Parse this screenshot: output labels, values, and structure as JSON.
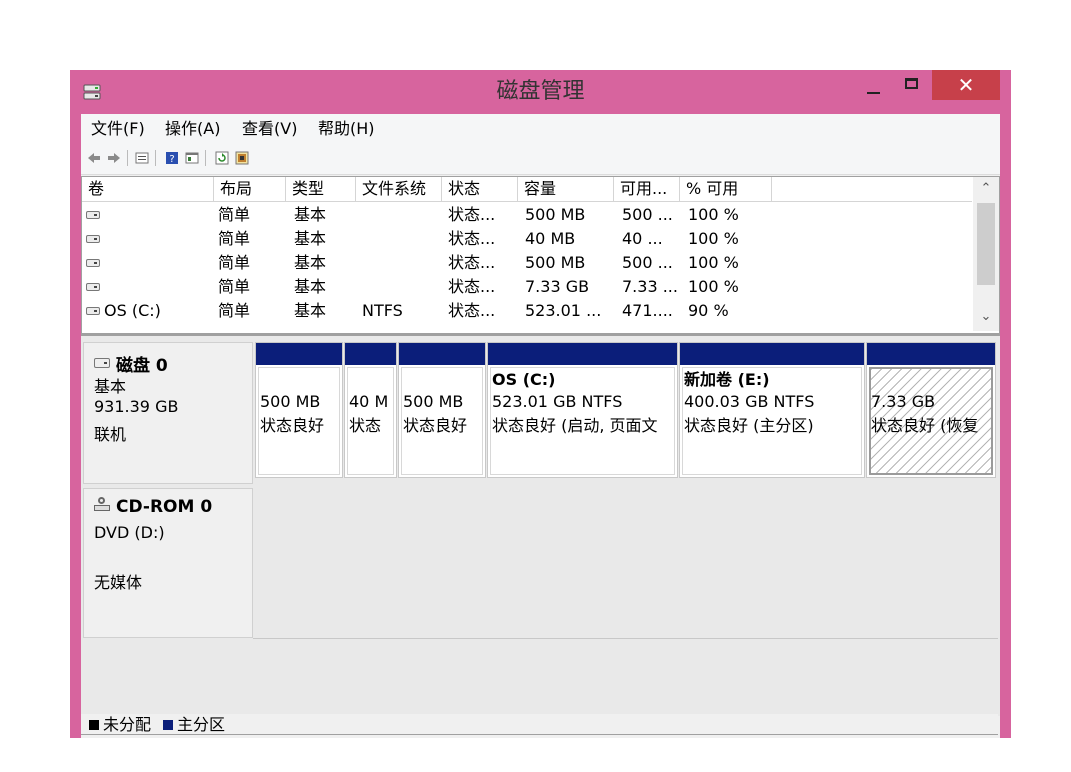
{
  "window": {
    "title": "磁盘管理",
    "close_glyph": "✕"
  },
  "menu": [
    {
      "label": "文件(F)"
    },
    {
      "label": "操作(A)"
    },
    {
      "label": "查看(V)"
    },
    {
      "label": "帮助(H)"
    }
  ],
  "toolbar": [
    "back-icon",
    "forward-icon",
    "properties-icon",
    "help-icon",
    "console-tree-icon",
    "refresh-icon",
    "settings-icon"
  ],
  "volumes": {
    "headers": [
      "卷",
      "布局",
      "类型",
      "文件系统",
      "状态",
      "容量",
      "可用...",
      "% 可用"
    ],
    "rows": [
      {
        "name": "",
        "layout": "简单",
        "type": "基本",
        "fs": "",
        "status": "状态...",
        "capacity": "500 MB",
        "free": "500 ...",
        "pct": "100 %"
      },
      {
        "name": "",
        "layout": "简单",
        "type": "基本",
        "fs": "",
        "status": "状态...",
        "capacity": "40 MB",
        "free": "40 ...",
        "pct": "100 %"
      },
      {
        "name": "",
        "layout": "简单",
        "type": "基本",
        "fs": "",
        "status": "状态...",
        "capacity": "500 MB",
        "free": "500 ...",
        "pct": "100 %"
      },
      {
        "name": "",
        "layout": "简单",
        "type": "基本",
        "fs": "",
        "status": "状态...",
        "capacity": "7.33 GB",
        "free": "7.33 ...",
        "pct": "100 %"
      },
      {
        "name": "OS (C:)",
        "layout": "简单",
        "type": "基本",
        "fs": "NTFS",
        "status": "状态...",
        "capacity": "523.01 ...",
        "free": "471....",
        "pct": "90 %"
      }
    ]
  },
  "disks": [
    {
      "name": "磁盘 0",
      "type": "基本",
      "size": "931.39 GB",
      "state": "联机",
      "partitions": [
        {
          "title": "",
          "line1": "500 MB",
          "line2": "状态良好"
        },
        {
          "title": "",
          "line1": "40 M",
          "line2": "状态"
        },
        {
          "title": "",
          "line1": "500 MB",
          "line2": "状态良好"
        },
        {
          "title": "OS  (C:)",
          "line1": "523.01 GB NTFS",
          "line2": "状态良好 (启动, 页面文"
        },
        {
          "title": "新加卷  (E:)",
          "line1": "400.03 GB NTFS",
          "line2": "状态良好 (主分区)"
        },
        {
          "title": "",
          "line1": "7.33 GB",
          "line2": "状态良好 (恢复"
        }
      ]
    },
    {
      "name": "CD-ROM 0",
      "type": "DVD (D:)",
      "size": "",
      "state": "无媒体"
    }
  ],
  "legend": [
    {
      "label": "未分配",
      "color": "#000000"
    },
    {
      "label": "主分区",
      "color": "#0b1e7a"
    }
  ]
}
